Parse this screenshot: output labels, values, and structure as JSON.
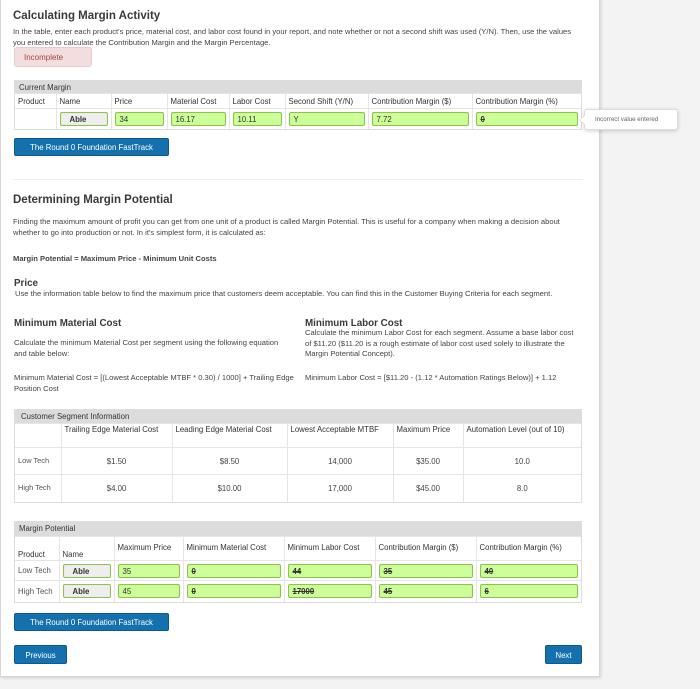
{
  "activity": {
    "title": "Calculating Margin Activity",
    "instructions": "In the table, enter each product's price, material cost, and labor cost found in your report, and note whether or not a second shift was used (Y/N). Then, use the values you entered to calculate the Contribution Margin and the Margin Percentage.",
    "status": "Incomplete"
  },
  "current_margin": {
    "title": "Current Margin",
    "columns": [
      "Product",
      "Name",
      "Price",
      "Material Cost",
      "Labor Cost",
      "Second Shift (Y/N)",
      "Contribution Margin ($)",
      "Contribution Margin (%)"
    ],
    "row": {
      "product": "",
      "name": "Able",
      "price": "34",
      "material_cost": "16.17",
      "labor_cost": "10.11",
      "second_shift": "Y",
      "contribution_margin_dollar": "7.72",
      "contribution_margin_pct": "0"
    },
    "tooltip": "Incorrect value entered"
  },
  "fasttrack_label": "The Round 0 Foundation FastTrack",
  "potential": {
    "title": "Determining Margin Potential",
    "intro": "Finding the maximum amount of profit you can get from one unit of a product is called Margin Potential. This is useful for a company when making a decision about whether to go into production or not. In it's simplest form, it is calculated as:",
    "formula": "Margin Potential = Maximum Price - Minimum Unit Costs",
    "price_heading": "Price",
    "price_text": "Use the information table below to find the maximum price that customers deem acceptable. You can find this in the Customer Buying Criteria for each segment.",
    "material_heading": "Minimum Material Cost",
    "material_text": "Calculate the minimum Material Cost per segment using the following equation and table below:",
    "material_formula": "Minimum Material Cost = [(Lowest Acceptable MTBF * 0.30) / 1000] + Trailing Edge Position Cost",
    "labor_heading": "Minimum Labor Cost",
    "labor_text": "Calculate the minimum Labor Cost for each segment. Assume a base labor cost of $11.20 ($11.20 is a rough estimate of labor cost used solely to illustrate the Margin Potential Concept).",
    "labor_formula": "Minimum Labor Cost = [$11.20 - (1.12 * Automation Ratings Below)] + 1.12"
  },
  "segment_info": {
    "title": "Customer Segment Information",
    "columns": [
      "",
      "Trailing Edge Material Cost",
      "Leading Edge Material Cost",
      "Lowest Acceptable MTBF",
      "Maximum Price",
      "Automation Level (out of 10)"
    ],
    "rows": [
      [
        "Low Tech",
        "$1.50",
        "$8.50",
        "14,000",
        "$35.00",
        "10.0"
      ],
      [
        "High Tech",
        "$4.00",
        "$10.00",
        "17,000",
        "$45.00",
        "8.0"
      ]
    ]
  },
  "margin_potential": {
    "title": "Margin Potential",
    "columns": [
      "Product",
      "Name",
      "Maximum Price",
      "Minimum Material Cost",
      "Minimum Labor Cost",
      "Contribution Margin ($)",
      "Contribution Margin (%)"
    ],
    "rows": [
      {
        "product": "Low Tech",
        "name": "Able",
        "max_price": "35",
        "min_material": "0",
        "min_labor": "44",
        "cm_dollar": "35",
        "cm_pct": "40"
      },
      {
        "product": "High Tech",
        "name": "Able",
        "max_price": "45",
        "min_material": "0",
        "min_labor": "17000",
        "cm_dollar": "45",
        "cm_pct": "6"
      }
    ]
  },
  "nav": {
    "previous": "Previous",
    "next": "Next"
  }
}
